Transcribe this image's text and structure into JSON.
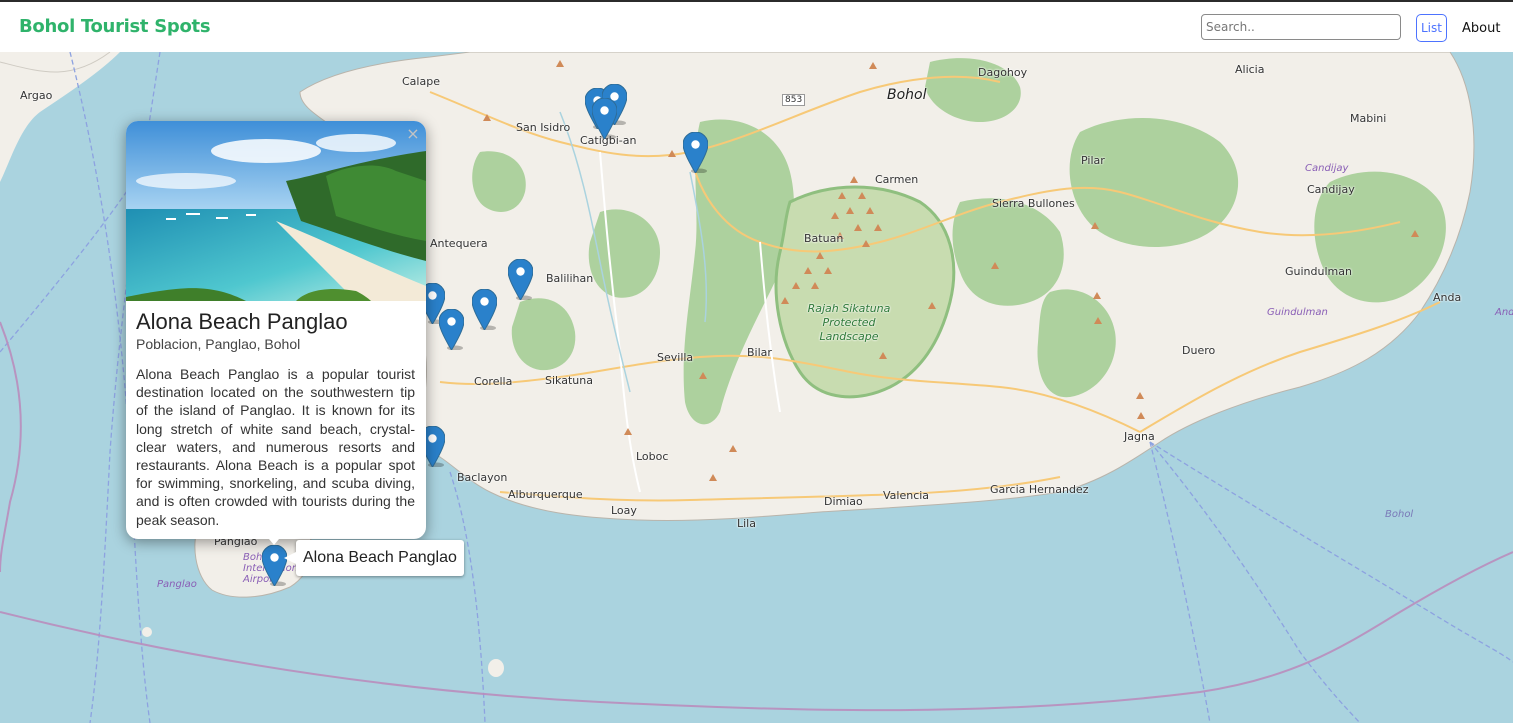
{
  "header": {
    "brand": "Bohol Tourist Spots",
    "search_placeholder": "Search..",
    "list_label": "List",
    "about_label": "About"
  },
  "colors": {
    "brand": "#2fb36b",
    "accent": "#4d73ff",
    "water": "#aad3df",
    "land": "#f2efe9",
    "forest": "#add19e",
    "marker": "#2a81cb"
  },
  "map": {
    "labels": {
      "argao": "Argao",
      "calape": "Calape",
      "san_isidro": "San Isidro",
      "catigbian": "Catigbi-an",
      "dagohoy": "Dagohoy",
      "bohol": "Bohol",
      "alicia": "Alicia",
      "mabini": "Mabini",
      "pilar": "Pilar",
      "carmen": "Carmen",
      "sierra_bullones": "Sierra Bullones",
      "candijay": "Candijay",
      "candijay_water": "Candijay",
      "antequera": "Antequera",
      "batuan": "Batuan",
      "balilihan": "Balilihan",
      "guindulman": "Guindulman",
      "guindulman_water": "Guindulman",
      "anda": "Anda",
      "anda_water": "Anda",
      "rajah_sikatuna_1": "Rajah Sikatuna",
      "rajah_sikatuna_2": "Protected",
      "rajah_sikatuna_3": "Landscape",
      "sevilla": "Sevilla",
      "bilar": "Bilar",
      "duero": "Duero",
      "corella": "Corella",
      "sikatuna": "Sikatuna",
      "jagna": "Jagna",
      "loboc": "Loboc",
      "baclayon": "Baclayon",
      "alburquerque": "Alburquerque",
      "loay": "Loay",
      "dimiao": "Dimiao",
      "valencia": "Valencia",
      "garcia_hernandez": "Garcia Hernandez",
      "lila": "Lila",
      "bohol_water": "Bohol",
      "panglao": "Panglao",
      "panglao_water": "Panglao",
      "airport": "Bohol International Airport",
      "road_853": "853"
    },
    "popup": {
      "title": "Alona Beach Panglao",
      "address": "Poblacion, Panglao, Bohol",
      "description": "Alona Beach Panglao is a popular tourist destination located on the southwestern tip of the island of Panglao. It is known for its long stretch of white sand beach, crystal-clear waters, and numerous resorts and restaurants. Alona Beach is a popular spot for swimming, snorkeling, and scuba diving, and is often crowded with tourists during the peak season.",
      "close_icon": "×"
    },
    "tooltip": "Alona Beach Panglao"
  }
}
